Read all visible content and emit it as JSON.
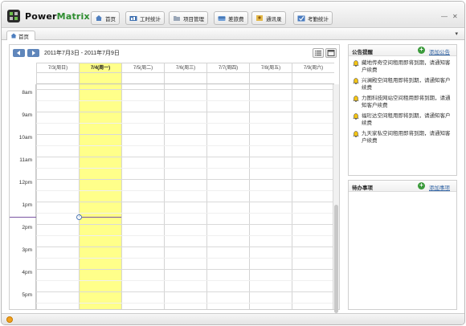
{
  "app": {
    "brand_prefix": "Power",
    "brand_accent": "Matrix",
    "minimize": "—",
    "close": "✕"
  },
  "nav": [
    {
      "label": "首页",
      "icon": "home-icon"
    },
    {
      "label": "工时统计",
      "icon": "chart-icon"
    },
    {
      "label": "项目管理",
      "icon": "folder-icon"
    },
    {
      "label": "差旅费",
      "icon": "card-icon"
    },
    {
      "label": "通讯录",
      "icon": "contacts-icon"
    },
    {
      "label": "考勤统计",
      "icon": "attendance-icon"
    }
  ],
  "tabs": {
    "home_label": "首页",
    "menu": "▾"
  },
  "calendar": {
    "date_range": "2011年7月3日 - 2011年7月9日",
    "days": [
      {
        "label": "7/3(周日)",
        "today": false
      },
      {
        "label": "7/4(周一)",
        "today": true
      },
      {
        "label": "7/5(周二)",
        "today": false
      },
      {
        "label": "7/6(周三)",
        "today": false
      },
      {
        "label": "7/7(周四)",
        "today": false
      },
      {
        "label": "7/8(周五)",
        "today": false
      },
      {
        "label": "7/9(周六)",
        "today": false
      }
    ],
    "hours": [
      "8am",
      "9am",
      "10am",
      "11am",
      "12pm",
      "1pm",
      "2pm",
      "3pm",
      "4pm",
      "5pm"
    ],
    "now_marker": "?"
  },
  "announcements": {
    "title": "公告提醒",
    "add_label": "添加公告",
    "items": [
      "藏地传奇空间租用即将到期，请通知客户续费",
      "兴澜殿空间租用即将到期，请通知客户续费",
      "力图科技网站空间租用即将到期，请通知客户续费",
      "福珩达空间租用即将到期，请通知客户续费",
      "九天家私空间租用即将到期，请通知客户续费"
    ]
  },
  "todo": {
    "title": "待办事项",
    "add_label": "添加事项"
  },
  "colors": {
    "accent": "#2d8d2f",
    "today_bg": "#ffff8a",
    "link": "#2f62a3",
    "nav_arrow": "#5f86bb"
  }
}
